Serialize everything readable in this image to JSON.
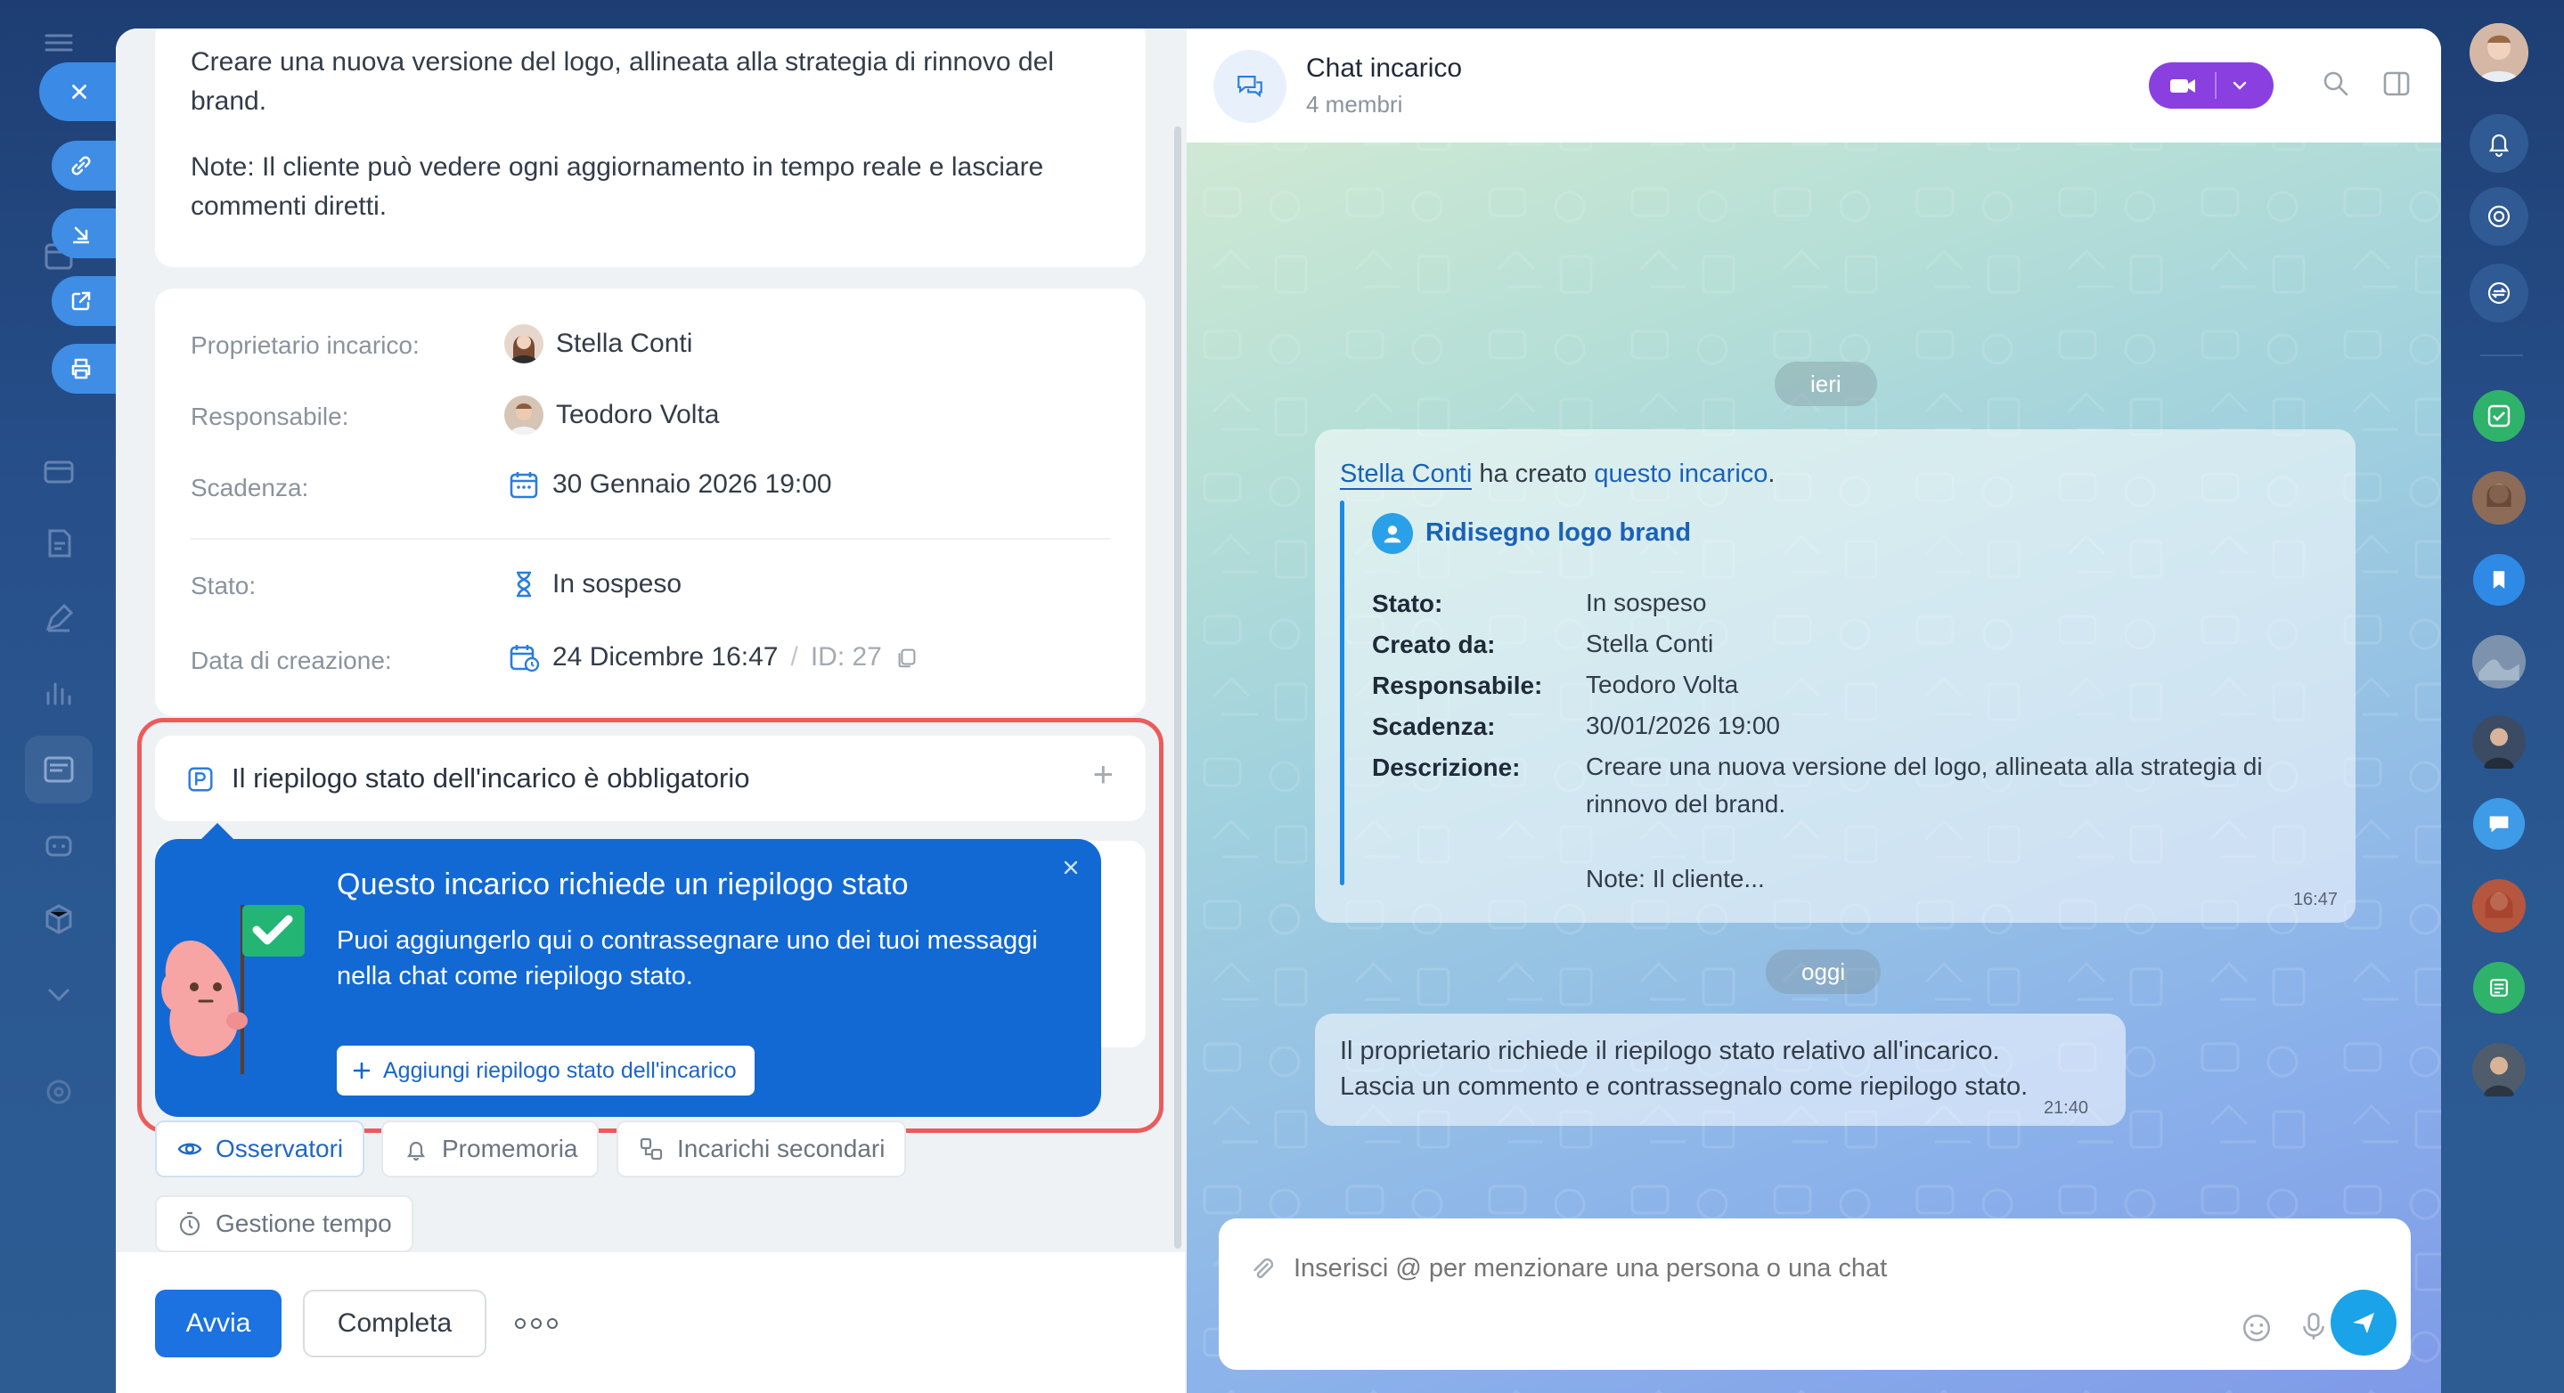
{
  "task": {
    "description_line1": "Creare una nuova versione del logo, allineata alla strategia di rinnovo del",
    "description_line2": "brand.",
    "note_line1": "Note: Il cliente può vedere ogni aggiornamento in tempo reale e lasciare",
    "note_line2": "commenti diretti."
  },
  "fields": {
    "owner_label": "Proprietario incarico:",
    "owner_value": "Stella Conti",
    "assignee_label": "Responsabile:",
    "assignee_value": "Teodoro Volta",
    "deadline_label": "Scadenza:",
    "deadline_value": "30 Gennaio 2026 19:00",
    "status_label": "Stato:",
    "status_value": "In sospeso",
    "created_label": "Data di creazione:",
    "created_value": "24 Dicembre 16:47",
    "id_sep": "/",
    "id_value": "ID: 27"
  },
  "summary": {
    "label": "Il riepilogo stato dell'incarico è obbligatorio",
    "add_symbol": "+"
  },
  "tooltip": {
    "title": "Questo incarico richiede un riepilogo stato",
    "text": "Puoi aggiungerlo qui o contrassegnare uno dei tuoi messaggi nella chat come riepilogo stato.",
    "button": "Aggiungi riepilogo stato dell'incarico"
  },
  "chips": {
    "observers": "Osservatori",
    "reminders": "Promemoria",
    "subtasks": "Incarichi secondari",
    "time": "Gestione tempo"
  },
  "footer": {
    "start": "Avvia",
    "complete": "Completa"
  },
  "chat": {
    "title": "Chat incarico",
    "members": "4 membri",
    "day_yesterday": "ieri",
    "day_today": "oggi",
    "msg1": {
      "author": "Stella Conti",
      "middle": " ha creato ",
      "link": "questo incarico",
      "end": ".",
      "task_title": "Ridisegno logo brand",
      "rows": [
        {
          "key": "Stato:",
          "value": "In sospeso"
        },
        {
          "key": "Creato da:",
          "value": "Stella Conti"
        },
        {
          "key": "Responsabile:",
          "value": "Teodoro Volta"
        },
        {
          "key": "Scadenza:",
          "value": "30/01/2026 19:00"
        },
        {
          "key": "Descrizione:",
          "value": "Creare una nuova versione del logo, allineata alla strategia di"
        }
      ],
      "desc_line2": "rinnovo del brand.",
      "desc_note": "Note: Il cliente...",
      "time": "16:47"
    },
    "msg2": {
      "line1": "Il proprietario richiede il riepilogo stato relativo all'incarico.",
      "line2": "Lascia un commento e contrassegnalo come riepilogo stato.",
      "time": "21:40"
    },
    "composer_placeholder": "Inserisci @ per menzionare una persona o una chat"
  },
  "colors": {
    "primary": "#1b72e0",
    "tooltip_bg": "#1269d3",
    "highlight_border": "#ec5b5b",
    "video_button": "#8a3fe0",
    "send_button": "#1aa3e8"
  }
}
